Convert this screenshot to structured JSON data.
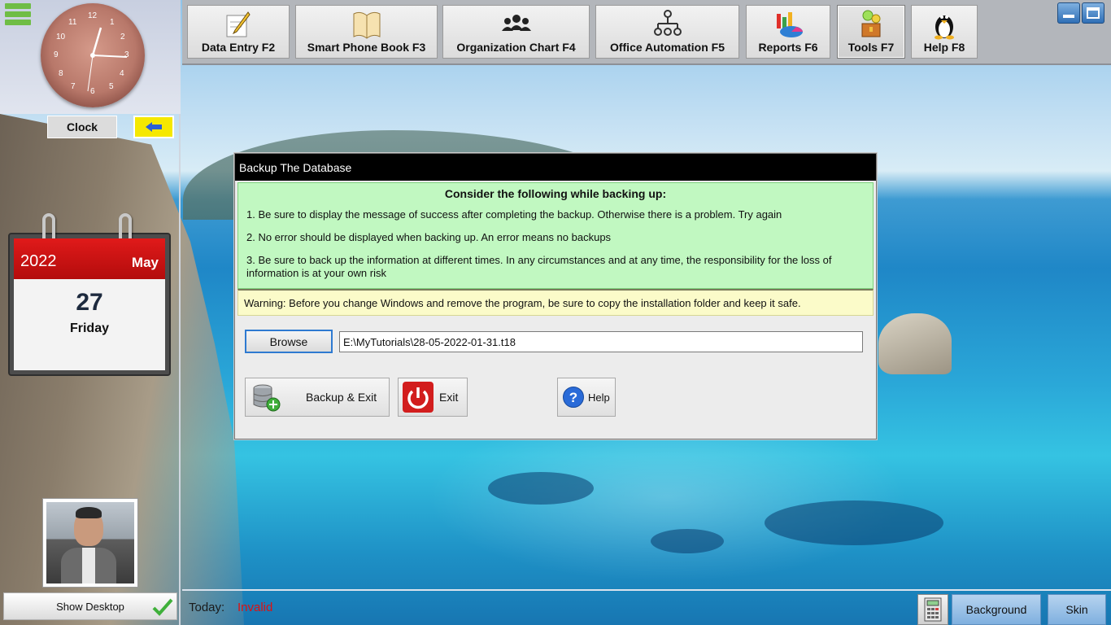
{
  "toolbar": {
    "items": [
      {
        "label": "Data Entry F2",
        "icon": "data-entry-icon"
      },
      {
        "label": "Smart Phone Book F3",
        "icon": "phone-book-icon"
      },
      {
        "label": "Organization Chart F4",
        "icon": "organization-chart-icon"
      },
      {
        "label": "Office Automation F5",
        "icon": "office-automation-icon"
      },
      {
        "label": "Reports F6",
        "icon": "reports-icon"
      },
      {
        "label": "Tools F7",
        "icon": "tools-icon"
      },
      {
        "label": "Help F8",
        "icon": "penguin-icon"
      }
    ],
    "active": "Tools F7"
  },
  "clock": {
    "label": "Clock",
    "numbers": [
      "12",
      "1",
      "2",
      "3",
      "4",
      "5",
      "6",
      "7",
      "8",
      "9",
      "10",
      "11"
    ]
  },
  "calendar": {
    "year": "2022",
    "month": "May",
    "day": "27",
    "weekday": "Friday"
  },
  "left_panel": {
    "show_desktop_label": "Show Desktop"
  },
  "bottom_bar": {
    "today_label": "Today:",
    "today_value": "Invalid",
    "background_label": "Background",
    "skin_label": "Skin"
  },
  "dialog": {
    "title": "Backup The Database",
    "notice_heading": "Consider the following while backing up:",
    "notice_lines": [
      "1. Be sure to display the message of success after completing the backup. Otherwise there is a problem. Try again",
      "2. No error should be displayed when backing up. An error means no backups",
      "3. Be sure to back up the information at different times. In any circumstances and at any time, the responsibility for the loss of information is at your own risk"
    ],
    "warning": "Warning: Before you change Windows and remove the program, be sure to  copy the installation folder and keep it safe.",
    "browse_label": "Browse",
    "path_value": "E:\\MyTutorials\\28-05-2022-01-31.t18",
    "backup_exit_label": "Backup & Exit",
    "exit_label": "Exit",
    "help_label": "Help"
  },
  "colors": {
    "notice_bg": "#c1f8c1",
    "warning_bg": "#fbfbc9",
    "calendar_red": "#d01414",
    "accent_green": "#6fbd45",
    "today_invalid": "#dd1111"
  }
}
